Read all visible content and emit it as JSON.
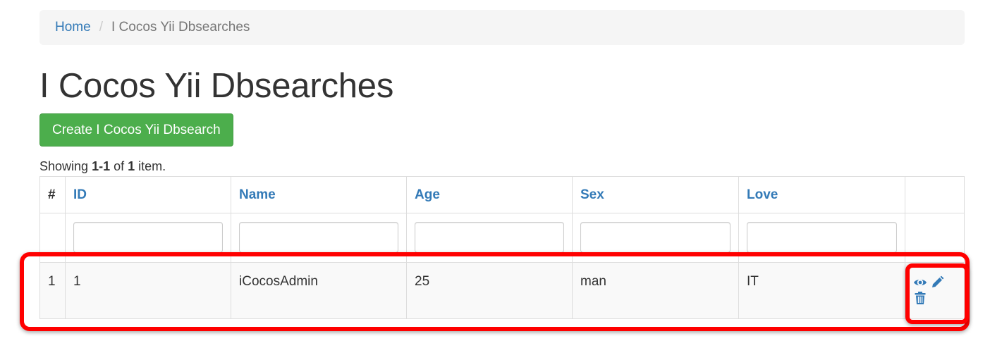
{
  "breadcrumb": {
    "home": "Home",
    "separator": "/",
    "current": "I Cocos Yii Dbsearches"
  },
  "page_title": "I Cocos Yii Dbsearches",
  "create_button": "Create I Cocos Yii Dbsearch",
  "summary": {
    "prefix": "Showing ",
    "range": "1-1",
    "middle": " of ",
    "total": "1",
    "suffix": " item."
  },
  "table": {
    "columns": {
      "serial": "#",
      "id": "ID",
      "name": "Name",
      "age": "Age",
      "sex": "Sex",
      "love": "Love"
    },
    "filters": {
      "id": "",
      "name": "",
      "age": "",
      "sex": "",
      "love": ""
    },
    "rows": [
      {
        "serial": "1",
        "id": "1",
        "name": "iCocosAdmin",
        "age": "25",
        "sex": "man",
        "love": "IT",
        "actions": [
          "eye-icon",
          "pencil-icon",
          "trash-icon"
        ]
      }
    ]
  },
  "colors": {
    "link": "#337ab7",
    "button_success": "#4cae4c",
    "highlight": "#ff0000",
    "breadcrumb_bg": "#f5f5f5"
  }
}
